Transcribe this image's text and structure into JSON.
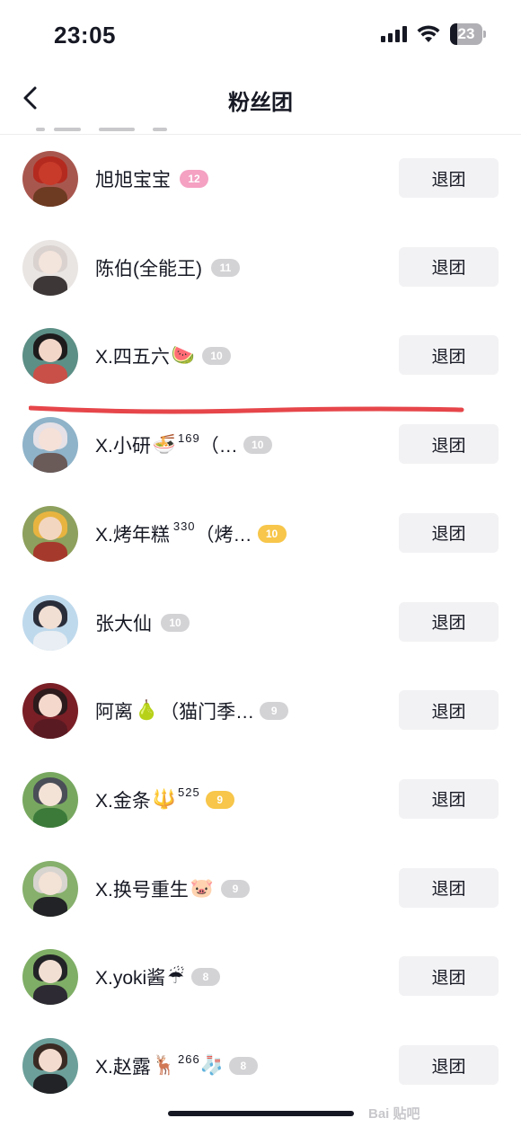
{
  "status_bar": {
    "time": "23:05",
    "battery": "23",
    "battery_level": 0.23
  },
  "header": {
    "title": "粉丝团"
  },
  "members": [
    {
      "name": "旭旭宝宝",
      "emoji": "",
      "sup": "",
      "suffix": "",
      "level": "12",
      "badge_color": "pink",
      "quit_label": "退团",
      "avatar_bg": "#a8574f",
      "avatar_hair": "#b42a1f",
      "avatar_face": "#c83a2a",
      "avatar_body": "#6d3b22"
    },
    {
      "name": "陈伯(全能王)",
      "emoji": "",
      "sup": "",
      "suffix": "",
      "level": "11",
      "badge_color": "gray",
      "quit_label": "退团",
      "avatar_bg": "#e9e5e3",
      "avatar_hair": "#d9d2cf",
      "avatar_face": "#f3e4dc",
      "avatar_body": "#3d3837"
    },
    {
      "name": "X.四五六",
      "emoji": "🍉",
      "sup": "",
      "suffix": "",
      "level": "10",
      "badge_color": "gray",
      "quit_label": "退团",
      "avatar_bg": "#5c8f86",
      "avatar_hair": "#1e1b1c",
      "avatar_face": "#f2d6c8",
      "avatar_body": "#c85048"
    },
    {
      "name": "X.小研",
      "emoji": "🍜",
      "sup": "169",
      "suffix": "（…",
      "level": "10",
      "badge_color": "gray",
      "quit_label": "退团",
      "avatar_bg": "#8fb3c9",
      "avatar_hair": "#e5e1e6",
      "avatar_face": "#f5e1d8",
      "avatar_body": "#6a5a58"
    },
    {
      "name": "X.烤年糕",
      "emoji": "",
      "sup": "330",
      "suffix": "（烤…",
      "level": "10",
      "badge_color": "gold",
      "quit_label": "退团",
      "avatar_bg": "#8ea05d",
      "avatar_hair": "#e8b440",
      "avatar_face": "#f3d6bf",
      "avatar_body": "#a53a2c"
    },
    {
      "name": "张大仙",
      "emoji": "",
      "sup": "",
      "suffix": "",
      "level": "10",
      "badge_color": "gray",
      "quit_label": "退团",
      "avatar_bg": "#bfd9ec",
      "avatar_hair": "#2a2e3a",
      "avatar_face": "#f2dfd3",
      "avatar_body": "#e8eef3"
    },
    {
      "name": "阿离",
      "emoji": "🍐",
      "sup": "",
      "suffix": "（猫门季…",
      "level": "9",
      "badge_color": "gray",
      "quit_label": "退团",
      "avatar_bg": "#7a1f26",
      "avatar_hair": "#2c1a1c",
      "avatar_face": "#f4d8cc",
      "avatar_body": "#5a1a22"
    },
    {
      "name": "X.金条",
      "emoji": "🔱",
      "sup": "525",
      "suffix": "",
      "level": "9",
      "badge_color": "gold",
      "quit_label": "退团",
      "avatar_bg": "#78a860",
      "avatar_hair": "#4a4e57",
      "avatar_face": "#f3e2d6",
      "avatar_body": "#3c7a3a"
    },
    {
      "name": "X.换号重生",
      "emoji": "🐷",
      "sup": "",
      "suffix": "",
      "level": "9",
      "badge_color": "gray",
      "quit_label": "退团",
      "avatar_bg": "#86b06c",
      "avatar_hair": "#d8d4d0",
      "avatar_face": "#f3e2d6",
      "avatar_body": "#222326"
    },
    {
      "name": "X.yoki酱",
      "emoji": "☔",
      "sup": "",
      "suffix": "",
      "level": "8",
      "badge_color": "gray",
      "quit_label": "退团",
      "avatar_bg": "#7fae66",
      "avatar_hair": "#222326",
      "avatar_face": "#f2dfd3",
      "avatar_body": "#2d2a33"
    },
    {
      "name": "X.赵露",
      "emoji": "🦌",
      "sup": "266",
      "suffix": "🧦",
      "level": "8",
      "badge_color": "gray",
      "quit_label": "退团",
      "avatar_bg": "#6c9f9a",
      "avatar_hair": "#3a2a24",
      "avatar_face": "#f3dccf",
      "avatar_body": "#222326"
    }
  ],
  "watermark": "Bai 贴吧"
}
